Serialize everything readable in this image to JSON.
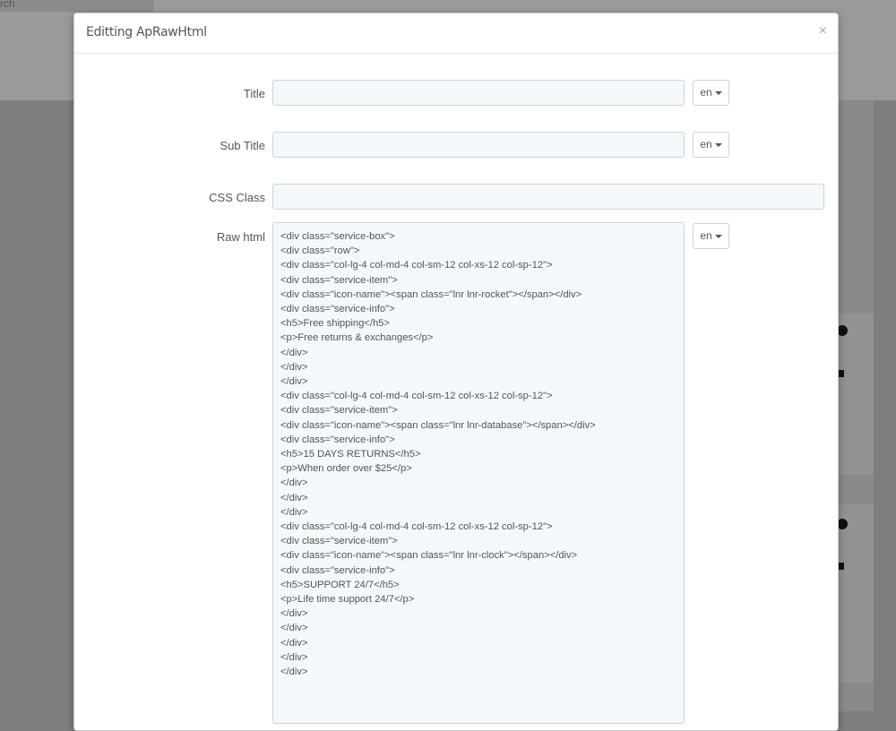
{
  "background": {
    "search_text": "rch"
  },
  "modal": {
    "title": "Editting ApRawHtml",
    "close_symbol": "×",
    "fields": {
      "title_label": "Title",
      "title_value": "",
      "title_lang": "en",
      "subtitle_label": "Sub Title",
      "subtitle_value": "",
      "subtitle_lang": "en",
      "cssclass_label": "CSS Class",
      "cssclass_value": "",
      "rawhtml_label": "Raw html",
      "rawhtml_lang": "en",
      "rawhtml_lines": [
        "<div class=\"service-box\">",
        "<div class=\"row\">",
        "<div class=\"col-lg-4 col-md-4 col-sm-12 col-xs-12 col-sp-12\">",
        "<div class=\"service-item\">",
        "<div class=\"icon-name\"><span class=\"lnr lnr-rocket\"></span></div>",
        "<div class=\"service-info\">",
        "<h5>Free shipping</h5>",
        "<p>Free returns & exchanges</p>",
        "</div>",
        "</div>",
        "</div>",
        "<div class=\"col-lg-4 col-md-4 col-sm-12 col-xs-12 col-sp-12\">",
        "<div class=\"service-item\">",
        "<div class=\"icon-name\"><span class=\"lnr lnr-database\"></span></div>",
        "<div class=\"service-info\">",
        "<h5>15 DAYS RETURNS</h5>",
        "<p>When order over $25</p>",
        "</div>",
        "</div>",
        "</div>",
        "<div class=\"col-lg-4 col-md-4 col-sm-12 col-xs-12 col-sp-12\">",
        "<div class=\"service-item\">",
        "<div class=\"icon-name\"><span class=\"lnr lnr-clock\"></span></div>",
        "<div class=\"service-info\">",
        "<h5>SUPPORT 24/7</h5>",
        "<p>Life time support 24/7</p>",
        "</div>",
        "</div>",
        "</div>",
        "</div>",
        "</div>"
      ]
    }
  },
  "colors": {
    "overlay": "#7e7e7e",
    "field_bg": "#f4f8fa",
    "field_border": "#c7d6db",
    "text": "#555555"
  }
}
